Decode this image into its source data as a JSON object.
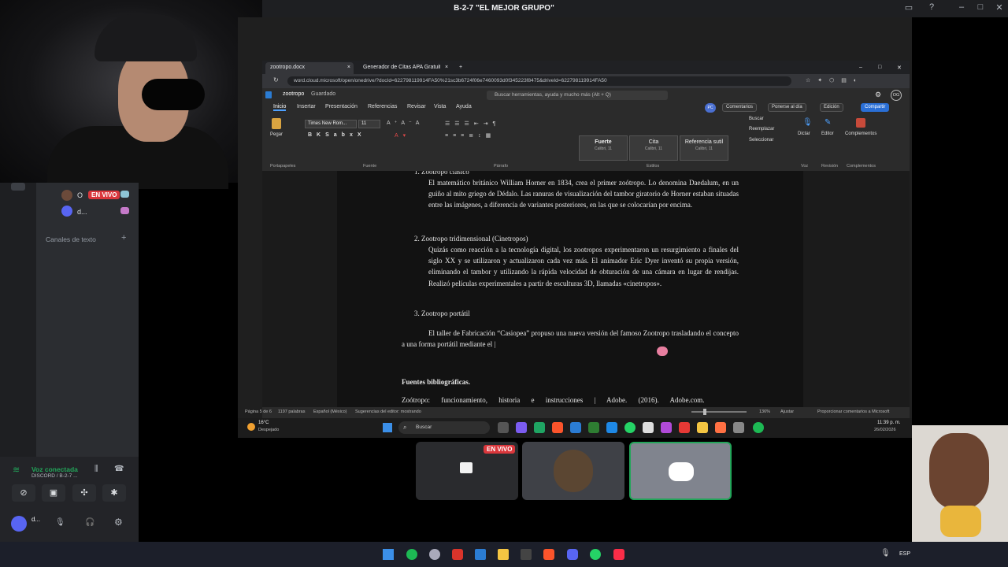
{
  "discord": {
    "window_title": "B-2-7 \"EL MEJOR GRUPO\"",
    "live_label": "EN VIVO",
    "users": [
      {
        "name": "O",
        "live": true
      },
      {
        "name": "d..."
      }
    ],
    "text_channels_label": "Canales de texto",
    "voice_status": "Voz conectada",
    "voice_channel": "DISCORD / B-2-7 ...",
    "self_name": "d..."
  },
  "browser": {
    "tabs": [
      {
        "label": "zootropo.docx"
      },
      {
        "label": "Generador de Citas APA Gratuito"
      }
    ],
    "url": "word.cloud.microsoft/open/onedrive/?docId=622798119914FA50%21sc3b6724f06e7460093d0f345223f8475&driveId=622798119914FA50"
  },
  "word": {
    "doc_name": "zootropo",
    "save_status": "Guardado",
    "search_placeholder": "Buscar herramientas, ayuda y mucho más (Alt + Q)",
    "user_initials": "OG",
    "menu_tabs": [
      "Inicio",
      "Insertar",
      "Presentación",
      "Referencias",
      "Revisar",
      "Vista",
      "Ayuda"
    ],
    "buttons": {
      "comments": "Comentarios",
      "catch_up": "Ponerse al día",
      "edit": "Edición",
      "share": "Compartir"
    },
    "ribbon": {
      "paste": "Pegar",
      "clipboard": "Portapapeles",
      "font_name": "Times New Rom...",
      "font_size": "11",
      "font_group": "Fuente",
      "paragraph_group": "Párrafo",
      "styles_group": "Estilos",
      "styles": [
        {
          "name": "Fuerte",
          "font": "Calibri, 11"
        },
        {
          "name": "Cita",
          "font": "Calibri, 11"
        },
        {
          "name": "Referencia sutil",
          "font": "Calibri, 11"
        }
      ],
      "find": "Buscar",
      "replace": "Reemplazar",
      "select": "Seleccionar",
      "dictate": "Dictar",
      "editor": "Editor",
      "addins": "Complementos",
      "voice_group": "Voz",
      "review_group": "Revisión",
      "addins_group": "Complementos"
    },
    "document": {
      "item1_title": "1.  Zootropo clásico",
      "item1_body": "El matemático británico William Horner en 1834, crea el primer zoótropo. Lo denomina Daedalum, en un guiño al mito griego de Dédalo. Las ranuras de visualización del tambor giratorio de Horner estaban situadas entre las imágenes, a diferencia de variantes posteriores, en las que se colocarían por encima.",
      "item2_title": "2.  Zootropo tridimensional (Cinetropos)",
      "item2_body": "Quizás como reacción a la tecnología digital, los zootropos experimentaron un resurgimiento a finales del siglo XX y se utilizaron y actualizaron cada vez más. El animador Eric Dyer inventó su propia versión, eliminando el tambor y utilizando la rápida velocidad de obturación de una cámara en lugar de rendijas. Realizó películas experimentales a partir de esculturas 3D, llamadas «cinetropos».",
      "item3_title": "3.  Zootropo portátil",
      "para3": "El taller de Fabricación “Casiopea” propuso una nueva versión del famoso Zootropo trasladando el concepto a una forma portátil mediante el |",
      "sources_heading": "Fuentes bibliográficas.",
      "source1": "Zoótropo: funcionamiento, historia e instrucciones | Adobe. (2016). Adobe.com."
    },
    "status": {
      "page": "Página 5 de 6",
      "words": "1197 palabras",
      "language": "Español (México)",
      "suggestions": "Sugerencias del editor: mostrando",
      "zoom": "136%",
      "fit": "Ajustar",
      "feedback": "Proporcionar comentarios a Microsoft"
    }
  },
  "inner_taskbar": {
    "weather_temp": "16°C",
    "weather_desc": "Despejado",
    "search": "Buscar",
    "time": "11:39 p. m.",
    "date": "26/02/2026"
  },
  "tiles": {
    "live_label": "EN VIVO"
  },
  "os_taskbar": {
    "lang": "ESP"
  },
  "colors": {
    "discord_bg": "#2b2d31",
    "accent_blue": "#4ea1ff",
    "live_red": "#da373c",
    "discord_green": "#23a55a"
  }
}
